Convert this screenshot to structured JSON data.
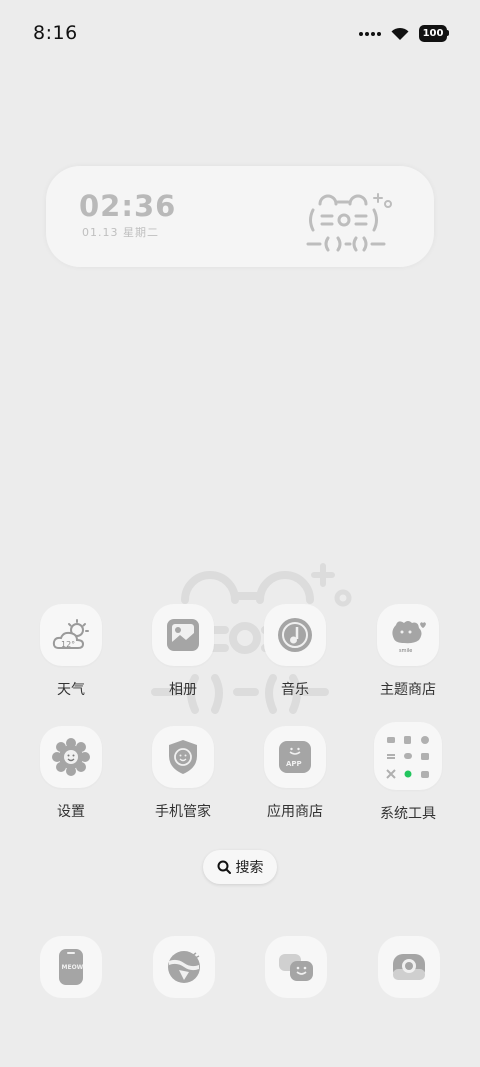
{
  "status_bar": {
    "time": "8:16",
    "battery": "100"
  },
  "clock_widget": {
    "time": "02:36",
    "date": "01.13 星期二"
  },
  "apps": [
    {
      "label": "天气",
      "icon": "weather-icon",
      "temp": "12°"
    },
    {
      "label": "相册",
      "icon": "gallery-icon"
    },
    {
      "label": "音乐",
      "icon": "music-icon"
    },
    {
      "label": "主题商店",
      "icon": "theme-store-icon",
      "badge_text": "smile"
    },
    {
      "label": "设置",
      "icon": "settings-icon"
    },
    {
      "label": "手机管家",
      "icon": "phone-manager-icon"
    },
    {
      "label": "应用商店",
      "icon": "app-store-icon",
      "badge_text": "APP"
    },
    {
      "label": "系统工具",
      "icon": "system-tools-folder-icon"
    }
  ],
  "search": {
    "label": "搜索"
  },
  "dock": [
    {
      "icon": "phone-icon",
      "badge_text": "MEOW"
    },
    {
      "icon": "browser-icon"
    },
    {
      "icon": "messages-icon"
    },
    {
      "icon": "camera-icon"
    }
  ],
  "colors": {
    "background": "#ececec",
    "tile": "#f7f7f7",
    "icon_gray": "#a8a8a8",
    "folder_green": "#22c55e"
  }
}
